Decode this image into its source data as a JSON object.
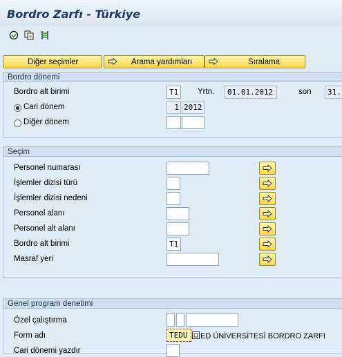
{
  "title": "Bordro Zarfı - Türkiye",
  "toolbar": {
    "icons": [
      "execute-icon",
      "copy-icon",
      "variants-icon"
    ]
  },
  "buttons": {
    "diger_secimler": "Diğer seçimler",
    "arama_yardimlari": "Arama yardımları",
    "siralama": "Sıralama"
  },
  "bordro_donemi": {
    "header": "Bordro dönemi",
    "bordro_alt_birimi_label": "Bordro alt birimi",
    "bordro_alt_birimi_value": "T1",
    "yrtn_label": "Yrtn.",
    "yrtn_value": "01.01.2012",
    "son_label": "son",
    "son_value": "31.",
    "cari_donem_label": "Cari dönem",
    "cari_donem_period": "1",
    "cari_donem_year": "2012",
    "diger_donem_label": "Diğer dönem",
    "selected": "cari"
  },
  "secim": {
    "header": "Seçim",
    "fields": [
      {
        "label": "Personel numarası",
        "value": ""
      },
      {
        "label": "İşlemler dizisi türü",
        "value": ""
      },
      {
        "label": "İşlemler dizisi nedeni",
        "value": ""
      },
      {
        "label": "Personel alanı",
        "value": ""
      },
      {
        "label": "Personel alt alanı",
        "value": ""
      },
      {
        "label": "Bordro alt birimi",
        "value": "T1"
      },
      {
        "label": "Masraf yeri",
        "value": ""
      }
    ]
  },
  "genel": {
    "header": "Genel program denetimi",
    "ozel_label": "Özel çalıştırma",
    "form_label": "Form adı",
    "form_value": "TEDU",
    "form_desc": "ED ÜNİVERSİTESİ BORDRO ZARFI",
    "cari_label": "Cari dönemi yazdır"
  },
  "colors": {
    "accent": "#f5d74a",
    "header_bg": "#d0dfee",
    "page_bg": "#dfebf5"
  }
}
